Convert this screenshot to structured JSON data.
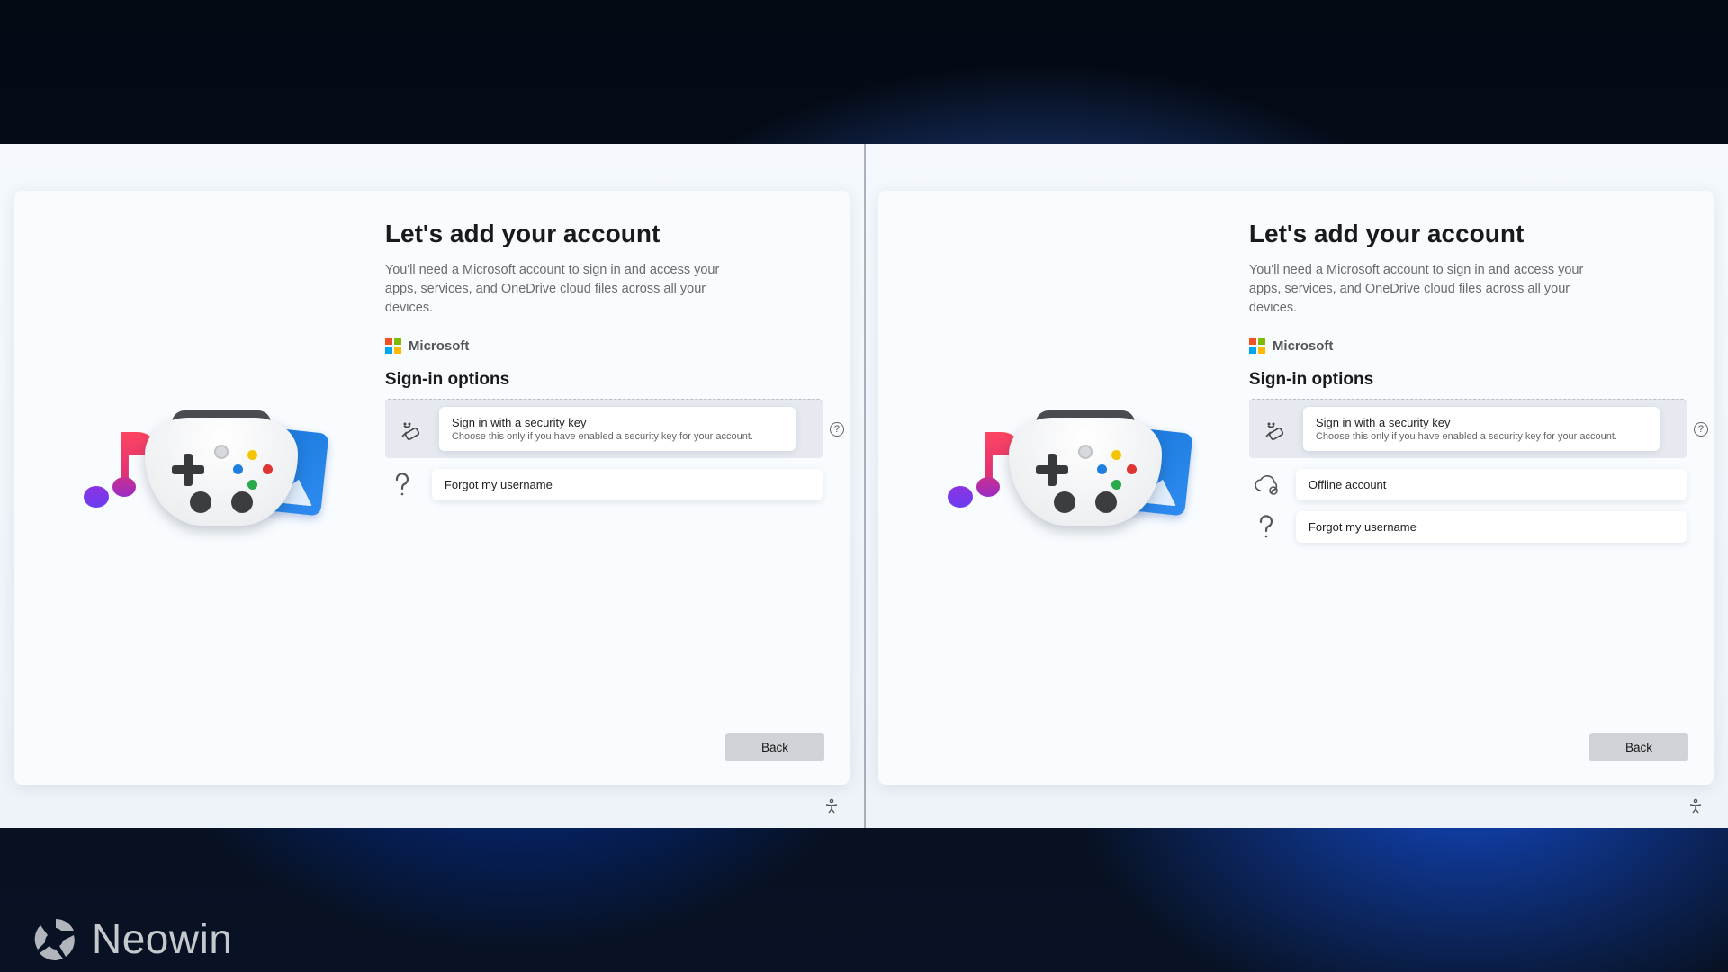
{
  "watermark": {
    "text": "Neowin"
  },
  "left": {
    "heading": "Let's add your account",
    "description": "You'll need a Microsoft account to sign in and access your apps, services, and OneDrive cloud files across all your devices.",
    "brand": "Microsoft",
    "subhead": "Sign-in options",
    "opt_security": {
      "title": "Sign in with a security key",
      "desc": "Choose this only if you have enabled a security key for your account."
    },
    "opt_forgot": {
      "title": "Forgot my username"
    },
    "back": "Back"
  },
  "right": {
    "heading": "Let's add your account",
    "description": "You'll need a Microsoft account to sign in and access your apps, services, and OneDrive cloud files across all your devices.",
    "brand": "Microsoft",
    "subhead": "Sign-in options",
    "opt_security": {
      "title": "Sign in with a security key",
      "desc": "Choose this only if you have enabled a security key for your account."
    },
    "opt_offline": {
      "title": "Offline account"
    },
    "opt_forgot": {
      "title": "Forgot my username"
    },
    "back": "Back"
  }
}
